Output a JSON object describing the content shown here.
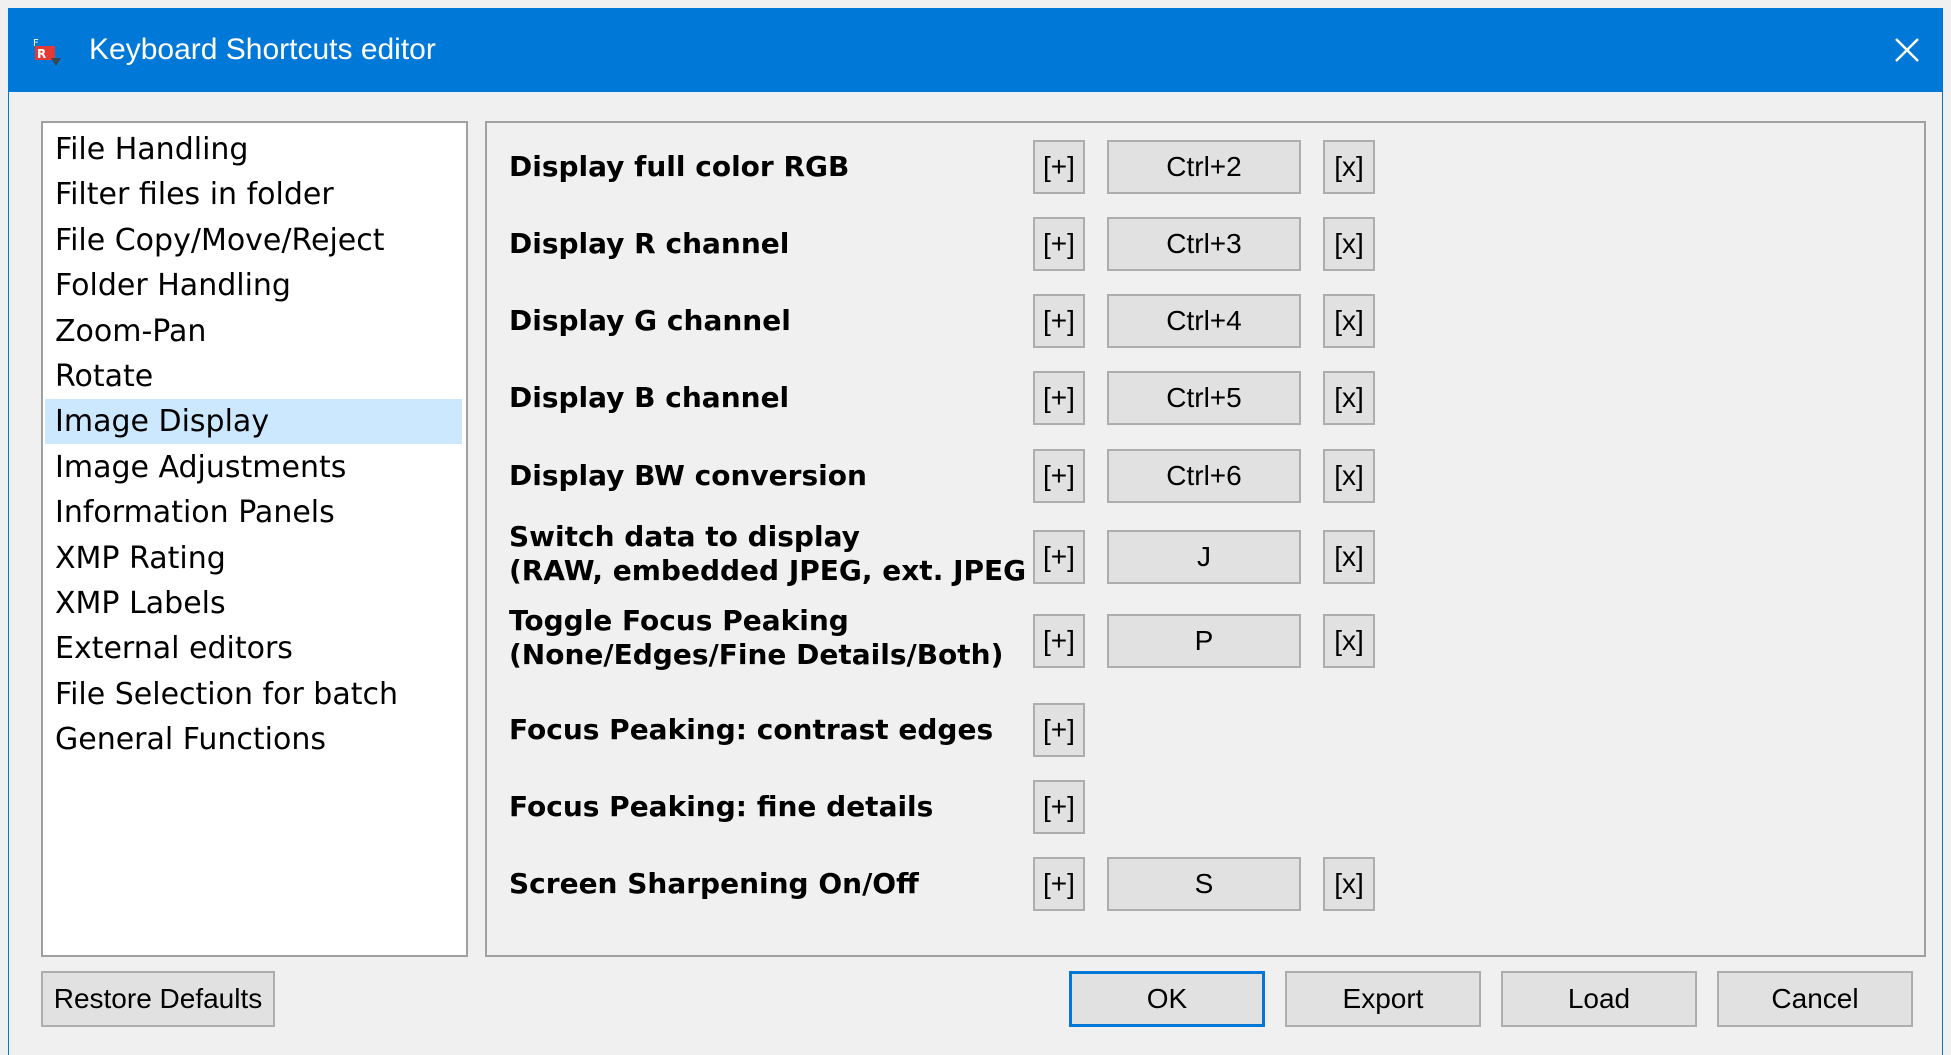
{
  "window": {
    "title": "Keyboard Shortcuts editor",
    "accent_color": "#0078d7",
    "close_icon": "close-icon"
  },
  "categories": [
    {
      "label": "File Handling",
      "selected": false
    },
    {
      "label": "Filter files in folder",
      "selected": false
    },
    {
      "label": "File Copy/Move/Reject",
      "selected": false
    },
    {
      "label": "Folder Handling",
      "selected": false
    },
    {
      "label": "Zoom-Pan",
      "selected": false
    },
    {
      "label": "Rotate",
      "selected": false
    },
    {
      "label": "Image Display",
      "selected": true
    },
    {
      "label": "Image Adjustments",
      "selected": false
    },
    {
      "label": "Information Panels",
      "selected": false
    },
    {
      "label": "XMP Rating",
      "selected": false
    },
    {
      "label": "XMP Labels",
      "selected": false
    },
    {
      "label": "External editors",
      "selected": false
    },
    {
      "label": "File Selection for batch",
      "selected": false
    },
    {
      "label": "General Functions",
      "selected": false
    }
  ],
  "shortcuts": [
    {
      "label": "Display full color RGB",
      "add": "[+]",
      "key": "Ctrl+2",
      "remove": "[x]"
    },
    {
      "label": "Display R channel",
      "add": "[+]",
      "key": "Ctrl+3",
      "remove": "[x]"
    },
    {
      "label": "Display G channel",
      "add": "[+]",
      "key": "Ctrl+4",
      "remove": "[x]"
    },
    {
      "label": "Display B channel",
      "add": "[+]",
      "key": "Ctrl+5",
      "remove": "[x]"
    },
    {
      "label": "Display BW conversion",
      "add": "[+]",
      "key": "Ctrl+6",
      "remove": "[x]"
    },
    {
      "label": "Switch data to display\n(RAW, embedded JPEG, ext. JPEG",
      "add": "[+]",
      "key": "J",
      "remove": "[x]"
    },
    {
      "label": "Toggle Focus Peaking\n(None/Edges/Fine Details/Both)",
      "add": "[+]",
      "key": "P",
      "remove": "[x]"
    },
    {
      "label": "Focus Peaking: contrast edges",
      "add": "[+]",
      "key": null,
      "remove": null
    },
    {
      "label": "Focus Peaking: fine details",
      "add": "[+]",
      "key": null,
      "remove": null
    },
    {
      "label": "Screen Sharpening On/Off",
      "add": "[+]",
      "key": "S",
      "remove": "[x]"
    }
  ],
  "footer": {
    "restore_defaults": "Restore Defaults",
    "ok": "OK",
    "export": "Export",
    "load": "Load",
    "cancel": "Cancel"
  }
}
